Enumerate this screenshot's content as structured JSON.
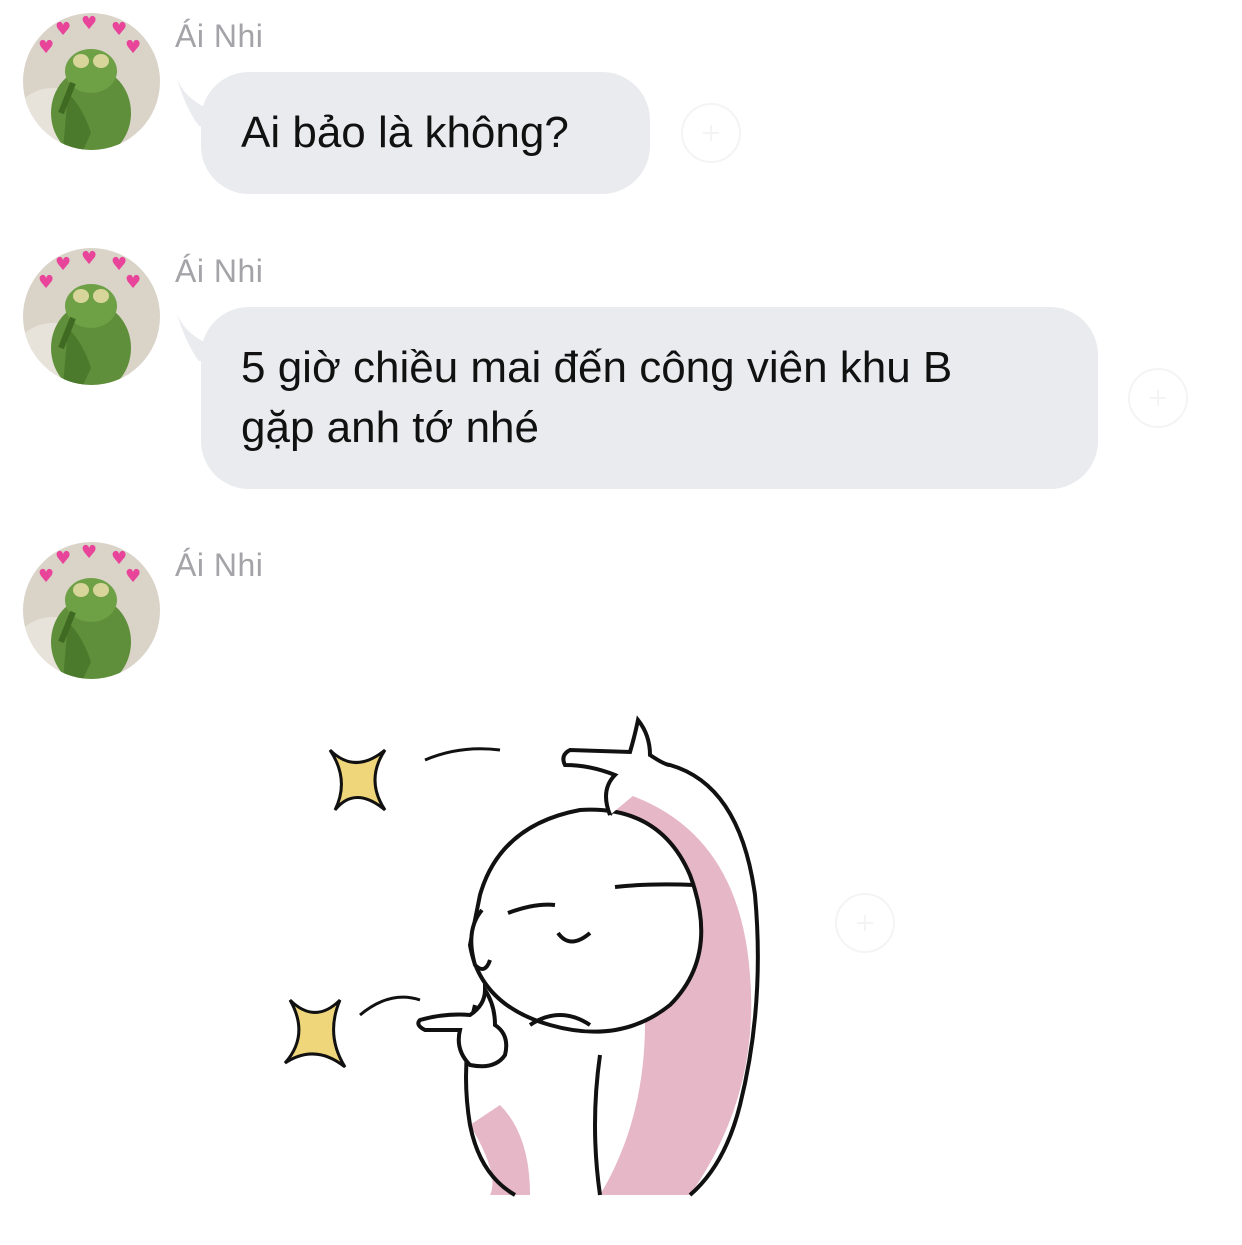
{
  "messages": [
    {
      "sender": "Ái Nhi",
      "type": "text",
      "text": "Ai bảo là không?"
    },
    {
      "sender": "Ái Nhi",
      "type": "text",
      "lines": [
        "5 giờ chiều mai đến công viên khu B",
        "gặp anh tớ nhé"
      ]
    },
    {
      "sender": "Ái Nhi",
      "type": "sticker",
      "sticker": "pointing-character-sticker"
    }
  ],
  "colors": {
    "bubble": "#e9ebee",
    "sender_name": "#a3a3a8",
    "text": "#111111",
    "sticker_pink": "#e6b7c6",
    "sparkle": "#f0d67a"
  },
  "icons": [
    "avatar-kermit-hearts",
    "add-reaction-icon"
  ]
}
